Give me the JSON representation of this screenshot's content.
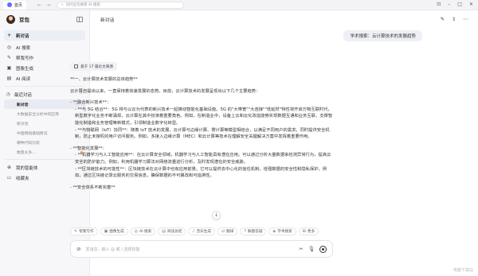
{
  "titlebar": {
    "tab_label": "首页",
    "address_text": "问问豆包搜索 AI 搜索"
  },
  "sidebar": {
    "user_name": "豆包",
    "items": [
      {
        "label": "新对话",
        "icon": "plus-icon"
      },
      {
        "label": "AI 搜索",
        "icon": "search-icon"
      },
      {
        "label": "帮我写作",
        "icon": "pen-icon"
      },
      {
        "label": "图像生成",
        "icon": "image-icon"
      },
      {
        "label": "AI 阅读",
        "icon": "book-icon"
      }
    ],
    "recent_label": "最近对话",
    "recent": [
      {
        "label": "新对话",
        "active": true
      },
      {
        "label": "大数据安全分析中的应用"
      },
      {
        "label": "新对话"
      },
      {
        "label": "中国网络基础情况"
      },
      {
        "label": "哪种代码比较"
      },
      {
        "label": "数量众多..."
      }
    ],
    "bottom": [
      {
        "label": "我的智能体",
        "icon": "bot-icon"
      },
      {
        "label": "收藏夹",
        "icon": "folder-icon"
      }
    ]
  },
  "main": {
    "title": "新对话",
    "user_message": "学术搜索：云计算技术的发展趋势",
    "refs_label": "基于 17 篇论文来源",
    "answer": [
      "**一、云计算技术发展的总体趋势**",
      "云计算自提出以来，一直保持着快速发展的态势。目前，云计算技术的发展呈现出以下几个主要趋势：",
      "- **融合新兴技术**：",
      "- **与 5G 结合**：5G 将与以云为代表的新兴技术一起推动智能化基础设施。5G 的\"大带宽\"\"大连接\"\"低延时\"特性将开启万物互联时代，新型数字化业务不断涌现，云计算在其中扮演着重要角色。例如，在制造业中，设备上云和云化改造能够实现数据互通和业务互联，支撑智能化制造和业务管理等新模式，引领制造业数字化转型。",
      "- **与物联网（IoT）协同**：随着 IoT 技术的发展，云计算与边缘计算、雾计算等模型相结合，以满足不同用户的需求。同时提供安全机制，防止未授权的用户访问服务。例如，多接入边缘计算（MEC）和云计算等技术在理解安全关键解决方案中发挥着重要作用。",
      "- **智能化发展**：",
      "- **机器学习与人工智能应用**：在云计算安全领域，机器学习与人工智能具有潜在应用。可以通过分析大量数据来检测异常行为，提高云安全的防护能力。例如，利用机器学习算法对网络流量进行分析，及时发现潜在的安全威胁。",
      "- **区块链技术的可能性**：区块链技术在云计算中也有应用前景。它可以提供去中心化的信任机制，增强数据的安全性和隐私保护。例如，通过区块链记录云服务的交易信息，确保数据的不可篡改和可追溯性。",
      "- **安全体系不断完善**"
    ],
    "tools": [
      {
        "label": "帮我写作",
        "icon": "pen-icon"
      },
      {
        "label": "图像生成",
        "icon": "image-icon"
      },
      {
        "label": "AI 搜索",
        "icon": "search-icon"
      },
      {
        "label": "阅读总结",
        "icon": "book-icon"
      },
      {
        "label": "音乐生成",
        "icon": "music-icon"
      },
      {
        "label": "翻译",
        "icon": "translate-icon"
      },
      {
        "label": "解题答疑",
        "icon": "question-icon"
      },
      {
        "label": "学术搜索",
        "icon": "academic-icon"
      },
      {
        "label": "更多",
        "icon": "grid-icon"
      }
    ],
    "input_placeholder": "发消息、输入 @ 或 / 选择技能"
  },
  "watermark": "电脑下载站"
}
